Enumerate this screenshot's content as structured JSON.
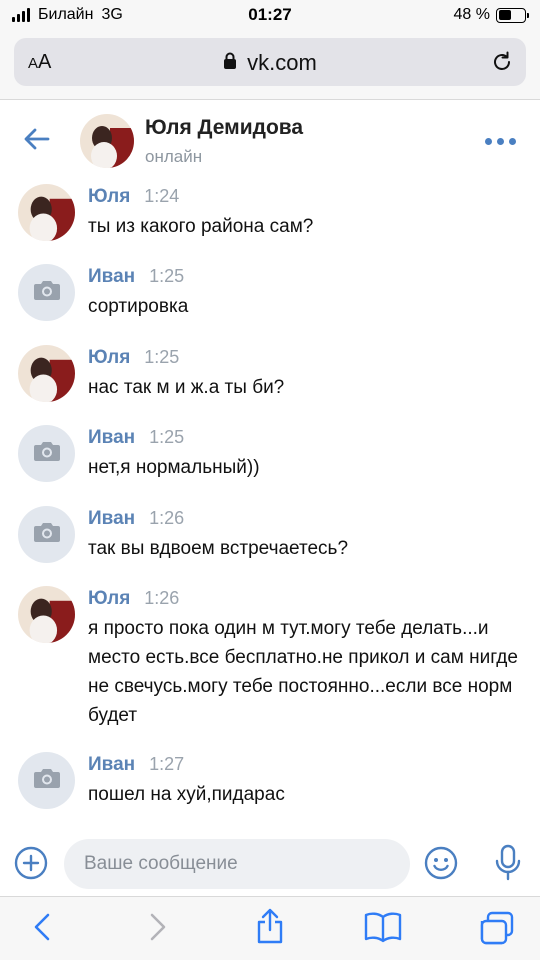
{
  "status_bar": {
    "carrier": "Билайн",
    "network": "3G",
    "time": "01:27",
    "battery_text": "48 %",
    "battery_level": 0.48
  },
  "browser": {
    "text_size_label_small": "A",
    "text_size_label_large": "A",
    "url": "vk.com"
  },
  "header": {
    "name": "Юля Демидова",
    "status": "онлайн"
  },
  "messages": [
    {
      "author": "Юля",
      "time": "1:24",
      "text": "ты из какого района сам?",
      "avatar": "photo"
    },
    {
      "author": "Иван",
      "time": "1:25",
      "text": "сортировка",
      "avatar": "camera-icon"
    },
    {
      "author": "Юля",
      "time": "1:25",
      "text": "нас так м и ж.а ты би?",
      "avatar": "photo"
    },
    {
      "author": "Иван",
      "time": "1:25",
      "text": "нет,я нормальный))",
      "avatar": "camera-icon"
    },
    {
      "author": "Иван",
      "time": "1:26",
      "text": "так вы вдвоем встречаетесь?",
      "avatar": "camera-icon"
    },
    {
      "author": "Юля",
      "time": "1:26",
      "text": "я просто пока один м тут.могу тебе делать...и место есть.все бесплатно.не прикол и сам нигде не свечусь.могу тебе постоянно...если все норм будет",
      "avatar": "photo"
    },
    {
      "author": "Иван",
      "time": "1:27",
      "text": "пошел на хуй,пидарас",
      "avatar": "camera-icon"
    }
  ],
  "composer": {
    "placeholder": "Ваше сообщение"
  },
  "colors": {
    "accent": "#4a7fc1",
    "author": "#5b83b5",
    "muted": "#9aa3ad",
    "placeholder_bg": "#e2e7ee"
  }
}
